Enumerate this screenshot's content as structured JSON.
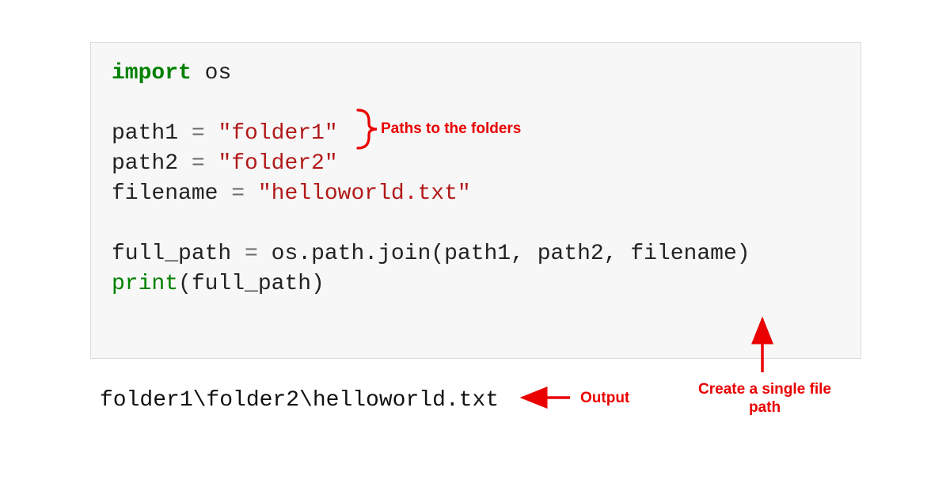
{
  "code": {
    "kw_import": "import",
    "module": "os",
    "blank": "",
    "var_path1": "path1",
    "eq": " = ",
    "str_folder1": "\"folder1\"",
    "var_path2": "path2",
    "str_folder2": "\"folder2\"",
    "var_filename": "filename",
    "str_hello": "\"helloworld.txt\"",
    "var_fullpath": "full_path",
    "ospathjoin": "os.path.join(path1, path2, filename)",
    "fn_print": "print",
    "print_arg": "(full_path)"
  },
  "output": "folder1\\folder2\\helloworld.txt",
  "annotations": {
    "paths_label": "Paths to the folders",
    "output_label": "Output",
    "create_label_line1": "Create a single file",
    "create_label_line2": "path"
  },
  "colors": {
    "annotation": "#ea0000",
    "keyword": "#008000",
    "string": "#b21919",
    "code_bg": "#f7f7f7"
  }
}
